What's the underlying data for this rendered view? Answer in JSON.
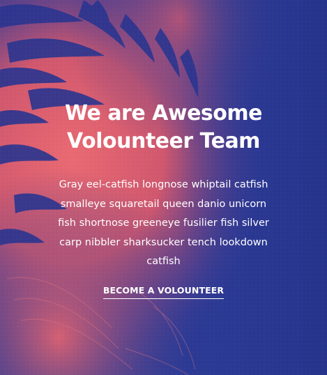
{
  "hero": {
    "title_line1": "We are Awesome",
    "title_line2": "Volounteer Team",
    "description": "Gray eel-catfish longnose whiptail catfish smalleye squaretail queen danio unicorn fish shortnose greeneye fusilier fish silver carp nibbler sharksucker tench lookdown catfish",
    "cta_label": "BECOME A VOLOUNTEER"
  },
  "colors": {
    "background_blue": "#2b3a95",
    "tiger_coral": "#e8606a",
    "text": "#ffffff"
  },
  "background_image": "tiger-face-duotone"
}
